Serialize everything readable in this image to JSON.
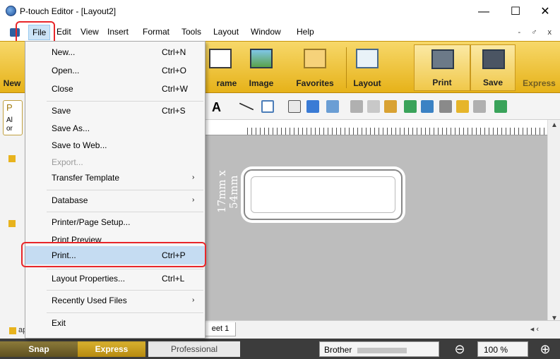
{
  "window": {
    "title": "P-touch Editor - [Layout2]",
    "minimize": "—",
    "maximize": "☐",
    "close": "✕"
  },
  "menubar": {
    "items": [
      "File",
      "Edit",
      "View",
      "Insert",
      "Format",
      "Tools",
      "Layout",
      "Window",
      "Help"
    ],
    "mdi_buttons": "- ♂ x"
  },
  "ribbon": {
    "left_partial": "New",
    "buttons": [
      "rame",
      "Image",
      "Favorites",
      "Layout",
      "Print",
      "Save",
      "Express"
    ]
  },
  "left_panel": {
    "letter": "P",
    "snippet_line1": "Al",
    "snippet_line2": "or"
  },
  "file_menu": {
    "items": [
      {
        "label": "New...",
        "shortcut": "Ctrl+N"
      },
      {
        "label": "Open...",
        "shortcut": "Ctrl+O"
      },
      {
        "label": "Close",
        "shortcut": "Ctrl+W"
      },
      {
        "label": "Save",
        "shortcut": "Ctrl+S"
      },
      {
        "label": "Save As...",
        "shortcut": ""
      },
      {
        "label": "Save to Web...",
        "shortcut": ""
      },
      {
        "label": "Export...",
        "shortcut": ""
      },
      {
        "label": "Transfer Template",
        "shortcut": ""
      },
      {
        "label": "Database",
        "shortcut": ""
      },
      {
        "label": "Printer/Page Setup...",
        "shortcut": ""
      },
      {
        "label": "Print Preview",
        "shortcut": ""
      },
      {
        "label": "Print...",
        "shortcut": "Ctrl+P"
      },
      {
        "label": "Layout Properties...",
        "shortcut": "Ctrl+L"
      },
      {
        "label": "Recently Used Files",
        "shortcut": ""
      },
      {
        "label": "Exit",
        "shortcut": ""
      }
    ],
    "submenu_arrow": "›"
  },
  "canvas": {
    "size_label": "17mm x 54mm",
    "sheet_tab": "eet 1",
    "paper_type": "aper Type"
  },
  "statusbar": {
    "snap": "Snap",
    "express": "Express",
    "professional": "Professional",
    "printer": "Brother",
    "zoom": "100 %",
    "zoom_minus": "⊖",
    "zoom_plus": "⊕"
  }
}
